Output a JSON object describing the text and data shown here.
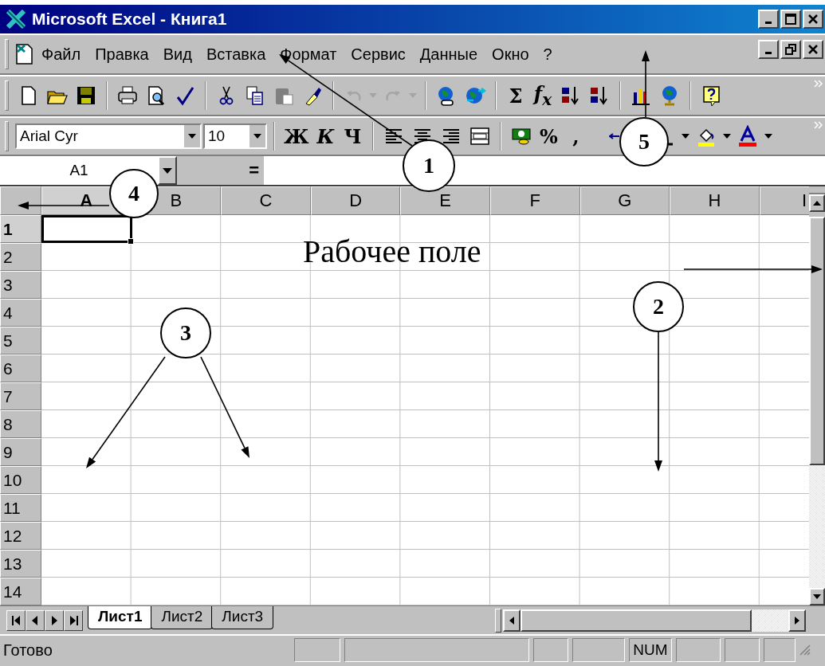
{
  "window": {
    "title": "Microsoft Excel - Книга1"
  },
  "menu": [
    {
      "label": "Файл"
    },
    {
      "label": "Правка"
    },
    {
      "label": "Вид"
    },
    {
      "label": "Вставка"
    },
    {
      "label": "Формат"
    },
    {
      "label": "Сервис"
    },
    {
      "label": "Данные"
    },
    {
      "label": "Окно"
    },
    {
      "label": "?"
    }
  ],
  "standard_toolbar": [
    {
      "kind": "new"
    },
    {
      "kind": "open"
    },
    {
      "kind": "save"
    },
    {
      "kind": "separator"
    },
    {
      "kind": "print"
    },
    {
      "kind": "preview"
    },
    {
      "kind": "spelling"
    },
    {
      "kind": "separator"
    },
    {
      "kind": "cut"
    },
    {
      "kind": "copy"
    },
    {
      "kind": "paste"
    },
    {
      "kind": "painter"
    },
    {
      "kind": "separator"
    },
    {
      "kind": "undo",
      "disabled": true
    },
    {
      "kind": "dropdown",
      "disabled": true
    },
    {
      "kind": "redo",
      "disabled": true
    },
    {
      "kind": "dropdown",
      "disabled": true
    },
    {
      "kind": "separator"
    },
    {
      "kind": "hyperlink"
    },
    {
      "kind": "web"
    },
    {
      "kind": "separator"
    },
    {
      "kind": "text",
      "label": "Σ"
    },
    {
      "kind": "text",
      "label": "*f$_{x}$*"
    },
    {
      "kind": "sort-up"
    },
    {
      "kind": "sort-down"
    },
    {
      "kind": "separator"
    },
    {
      "kind": "chart"
    },
    {
      "kind": "map"
    },
    {
      "kind": "separator"
    },
    {
      "kind": "help"
    }
  ],
  "formatting_toolbar": [
    {
      "kind": "font-name",
      "value": "Arial Cyr"
    },
    {
      "kind": "font-size",
      "value": "10"
    },
    {
      "kind": "separator"
    },
    {
      "kind": "text",
      "label": "Ж"
    },
    {
      "kind": "text",
      "label": "*К*"
    },
    {
      "kind": "text",
      "label": "Ч"
    },
    {
      "kind": "separator"
    },
    {
      "kind": "align-left"
    },
    {
      "kind": "align-center"
    },
    {
      "kind": "align-right"
    },
    {
      "kind": "merge"
    },
    {
      "kind": "separator"
    },
    {
      "kind": "currency"
    },
    {
      "kind": "text",
      "label": "%"
    },
    {
      "kind": "text",
      "label": ","
    },
    {
      "kind": "decimal"
    },
    {
      "kind": "borders"
    },
    {
      "kind": "dropdown"
    },
    {
      "kind": "fill"
    },
    {
      "kind": "dropdown"
    },
    {
      "kind": "font-color"
    },
    {
      "kind": "dropdown"
    }
  ],
  "formula_bar": {
    "name_box": "A1",
    "equals": "="
  },
  "columns": [
    {
      "label": "A",
      "selected": true
    },
    {
      "label": "B",
      "selected": false
    },
    {
      "label": "C",
      "selected": false
    },
    {
      "label": "D",
      "selected": false
    },
    {
      "label": "E",
      "selected": false
    },
    {
      "label": "F",
      "selected": false
    },
    {
      "label": "G",
      "selected": false
    },
    {
      "label": "H",
      "selected": false
    },
    {
      "label": "I",
      "selected": false
    }
  ],
  "rows": [
    {
      "label": "1",
      "selected": true
    },
    {
      "label": "2",
      "selected": false
    },
    {
      "label": "3",
      "selected": false
    },
    {
      "label": "4",
      "selected": false
    },
    {
      "label": "5",
      "selected": false
    },
    {
      "label": "6",
      "selected": false
    },
    {
      "label": "7",
      "selected": false
    },
    {
      "label": "8",
      "selected": false
    },
    {
      "label": "9",
      "selected": false
    },
    {
      "label": "10",
      "selected": false
    },
    {
      "label": "11",
      "selected": false
    },
    {
      "label": "12",
      "selected": false
    },
    {
      "label": "13",
      "selected": false
    },
    {
      "label": "14",
      "selected": false
    }
  ],
  "sheet_tabs": [
    {
      "label": "Лист1",
      "selected": true
    },
    {
      "label": "Лист2",
      "selected": false
    },
    {
      "label": "Лист3",
      "selected": false
    }
  ],
  "status_bar": {
    "text": "Готово",
    "panels": [
      {
        "kind": "blank"
      },
      {
        "kind": "blank"
      },
      {
        "kind": "blank"
      },
      {
        "kind": "blank"
      },
      {
        "kind": "text",
        "text": "NUM"
      },
      {
        "kind": "blank"
      },
      {
        "kind": "blank"
      },
      {
        "kind": "blank"
      }
    ]
  },
  "caption": "Рабочее поле",
  "callouts": [
    {
      "number": "1"
    },
    {
      "number": "5"
    },
    {
      "number": "4"
    },
    {
      "number": "2"
    },
    {
      "number": "3"
    }
  ]
}
